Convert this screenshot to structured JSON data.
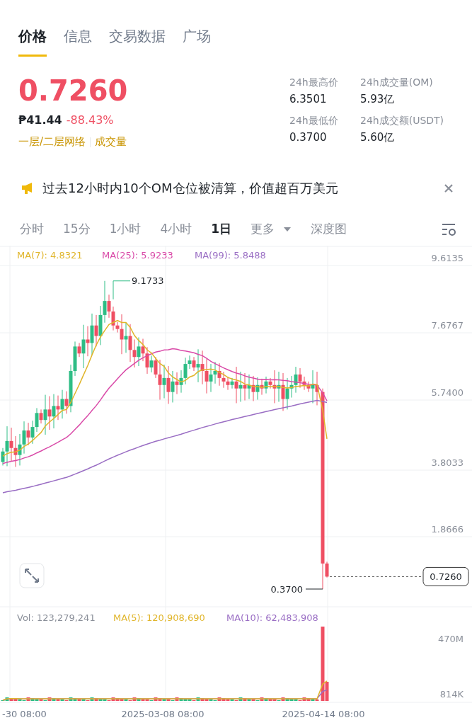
{
  "tabs": [
    {
      "label": "价格",
      "selected": true
    },
    {
      "label": "信息",
      "selected": false
    },
    {
      "label": "交易数据",
      "selected": false
    },
    {
      "label": "广场",
      "selected": false
    }
  ],
  "price": {
    "last": "0.7260",
    "fiat": "₱41.44",
    "change": "-88.43%"
  },
  "tags": [
    "一层/二层网络",
    "成交量"
  ],
  "stats": [
    {
      "label": "24h最高价",
      "value": "6.3501"
    },
    {
      "label": "24h成交量(OM)",
      "value": "5.93亿"
    },
    {
      "label": "24h最低价",
      "value": "0.3700"
    },
    {
      "label": "24h成交额(USDT)",
      "value": "5.60亿"
    }
  ],
  "notice": {
    "text": "过去12小时内10个OM仓位被清算，价值超百万美元"
  },
  "intervals": [
    {
      "label": "分时",
      "selected": false,
      "kind": "option"
    },
    {
      "label": "15分",
      "selected": false,
      "kind": "option"
    },
    {
      "label": "1小时",
      "selected": false,
      "kind": "option"
    },
    {
      "label": "4小时",
      "selected": false,
      "kind": "option"
    },
    {
      "label": "1日",
      "selected": true,
      "kind": "option"
    },
    {
      "label": "更多",
      "selected": false,
      "kind": "dropdown"
    },
    {
      "label": "深度图",
      "selected": false,
      "kind": "option"
    }
  ],
  "chart": {
    "ma_legend": [
      {
        "label": "MA(7): 4.8321",
        "color": "#e0b52a"
      },
      {
        "label": "MA(25): 5.9233",
        "color": "#d94aa8"
      },
      {
        "label": "MA(99): 5.8488",
        "color": "#9a6ec4"
      }
    ],
    "y_axis": [
      "9.6135",
      "7.6767",
      "5.7400",
      "3.8033",
      "1.8666"
    ],
    "high_label": "9.1733",
    "low_label": "0.3700",
    "current_price": "0.7260"
  },
  "volume": {
    "legend": [
      {
        "label": "Vol: 123,279,241",
        "color": "#8a8f99"
      },
      {
        "label": "MA(5): 120,908,690",
        "color": "#e0b52a"
      },
      {
        "label": "MA(10): 62,483,908",
        "color": "#9a6ec4"
      }
    ],
    "y_axis": [
      "470M",
      "814K"
    ]
  },
  "x_axis": [
    "-30 08:00",
    "2025-03-08 08:00",
    "2025-04-14 08:00"
  ]
}
